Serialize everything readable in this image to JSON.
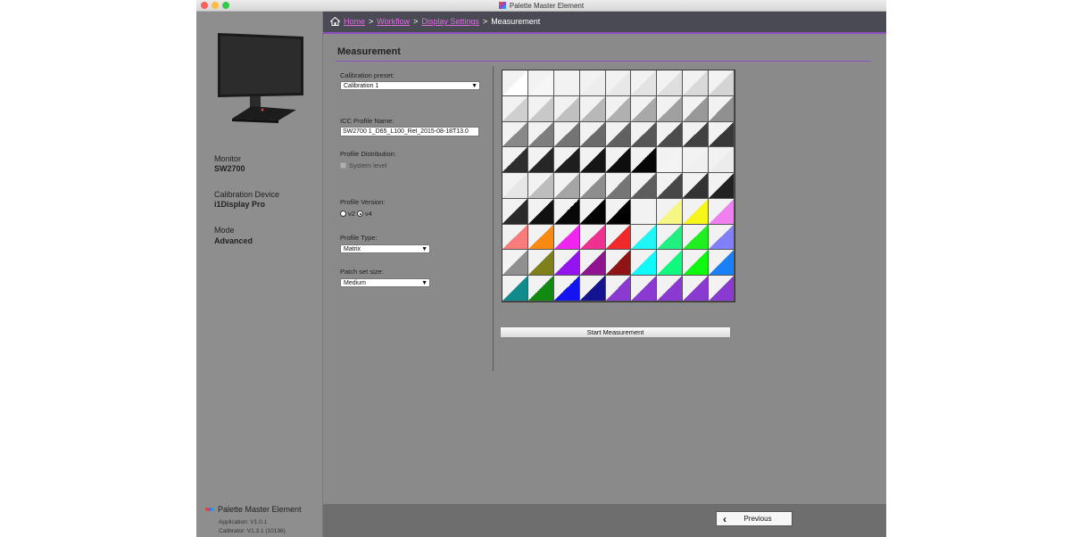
{
  "window": {
    "title": "Palette Master Element"
  },
  "breadcrumb": {
    "home": "Home",
    "workflow": "Workflow",
    "display_settings": "Display Settings",
    "separator": ">",
    "current": "Measurement"
  },
  "sidebar": {
    "monitor_label": "Monitor",
    "monitor_value": "SW2700",
    "device_label": "Calibration Device",
    "device_value": "i1Display Pro",
    "mode_label": "Mode",
    "mode_value": "Advanced",
    "app_name": "Palette Master Element",
    "application_version": "Application: V1.0.1",
    "calibrator_version": "Calibrator: V1.3.1 (10136)"
  },
  "main": {
    "section_title": "Measurement",
    "calibration_preset_label": "Calibration preset:",
    "calibration_preset_value": "Calibration 1",
    "icc_profile_label": "ICC Profile Name:",
    "icc_profile_value": "SW2700 1_D65_L100_Rel_2015-08-18T13.0",
    "profile_distribution_label": "Profile Distribution:",
    "system_level_label": "System level",
    "profile_version_label": "Profile Version:",
    "v2_label": "v2",
    "v4_label": "v4",
    "profile_type_label": "Profile Type:",
    "profile_type_value": "Matrix",
    "patch_set_label": "Patch set size:",
    "patch_set_value": "Medium",
    "start_button": "Start Measurement"
  },
  "footer": {
    "previous_button": "Previous"
  },
  "patches": [
    [
      "#ffffff",
      "#f6f6f6",
      "#f2f2f2",
      "#ededed",
      "#e8e8e8",
      "#e3e3e3",
      "#dedede",
      "#d9d9d9",
      "#d4d4d4"
    ],
    [
      "#cfcfcf",
      "#c8c8c8",
      "#c0c0c0",
      "#b8b8b8",
      "#b0b0b0",
      "#a8a8a8",
      "#a0a0a0",
      "#989898",
      "#909090"
    ],
    [
      "#888888",
      "#7e7e7e",
      "#747474",
      "#6a6a6a",
      "#606060",
      "#565656",
      "#4c4c4c",
      "#424242",
      "#383838"
    ],
    [
      "#2e2e2e",
      "#262626",
      "#1e1e1e",
      "#161616",
      "#0e0e0e",
      "#060606",
      "#f4f4f4",
      "#f0f0f0",
      "#ececec"
    ],
    [
      "#e6e6e6",
      "#bdbdbd",
      "#a5a5a5",
      "#8d8d8d",
      "#757575",
      "#5d5d5d",
      "#474747",
      "#333333",
      "#222222"
    ],
    [
      "#2a2a2a",
      "#111111",
      "#080808",
      "#040404",
      "#000000",
      "#f2f2f2",
      "#f6f684",
      "#f6f61a",
      "#f080f0"
    ],
    [
      "#f87c7c",
      "#f88a12",
      "#f026f0",
      "#f03090",
      "#f02a2a",
      "#20f6f6",
      "#20f080",
      "#20f020",
      "#8080f8"
    ],
    [
      "#909090",
      "#80801a",
      "#9414f0",
      "#901490",
      "#901414",
      "#10f8f8",
      "#10f880",
      "#10f810",
      "#1a80f8"
    ],
    [
      "#108a8a",
      "#108a10",
      "#1414f0",
      "#141490",
      "#8a3ad0",
      "#8a3ad0",
      "#8a3ad0",
      "#8a3ad0",
      "#8a3ad0"
    ]
  ]
}
